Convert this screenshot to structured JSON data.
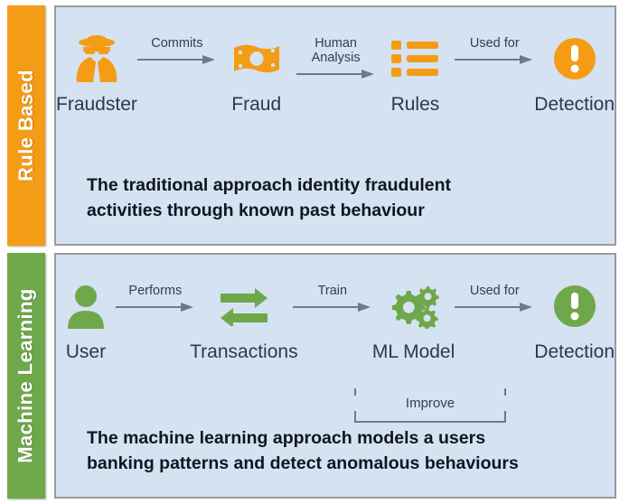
{
  "sections": [
    {
      "id": "rule-based",
      "tab_label": "Rule Based",
      "accent": "#F59C16",
      "panel_bg": "#D4E2F2",
      "caption_line1": "The traditional approach identity fraudulent",
      "caption_line2": "activities through known past behaviour",
      "nodes": [
        {
          "icon": "fraudster-icon",
          "label": "Fraudster"
        },
        {
          "icon": "banknote-icon",
          "label": "Fraud"
        },
        {
          "icon": "rules-list-icon",
          "label": "Rules"
        },
        {
          "icon": "alert-circle-icon",
          "label": "Detection"
        }
      ],
      "connectors": [
        {
          "label": "Commits"
        },
        {
          "label": "Human\nAnalysis"
        },
        {
          "label": "Used for"
        }
      ]
    },
    {
      "id": "machine-learning",
      "tab_label": "Machine Learning",
      "accent": "#6FA84A",
      "panel_bg": "#D4E2F2",
      "caption_line1": "The machine learning approach models a users",
      "caption_line2": "banking patterns and detect anomalous behaviours",
      "nodes": [
        {
          "icon": "user-icon",
          "label": "User"
        },
        {
          "icon": "exchange-arrows-icon",
          "label": "Transactions"
        },
        {
          "icon": "gears-icon",
          "label": "ML Model"
        },
        {
          "icon": "alert-circle-icon",
          "label": "Detection"
        }
      ],
      "connectors": [
        {
          "label": "Performs"
        },
        {
          "label": "Train"
        },
        {
          "label": "Used for"
        }
      ],
      "feedback_loop": {
        "label": "Improve"
      }
    }
  ],
  "colors": {
    "orange": "#F59C16",
    "green": "#6FA84A",
    "panel": "#D4E2F2",
    "border": "#9a9a9a",
    "arrow": "#6f7a86",
    "text": "#2b3a4a"
  }
}
